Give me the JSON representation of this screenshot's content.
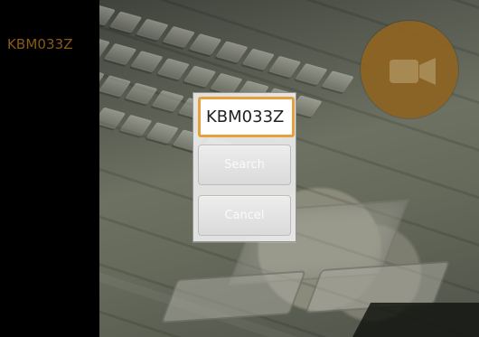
{
  "left_panel": {
    "plate_text": "KBM033Z"
  },
  "dialog": {
    "input_value": "KBM033Z",
    "search_label": "Search",
    "cancel_label": "Cancel"
  },
  "icons": {
    "record": "video-camera-icon"
  },
  "colors": {
    "plate_text": "#8a5a17",
    "record_button": "#8b6425",
    "input_border": "#e8a03d"
  }
}
